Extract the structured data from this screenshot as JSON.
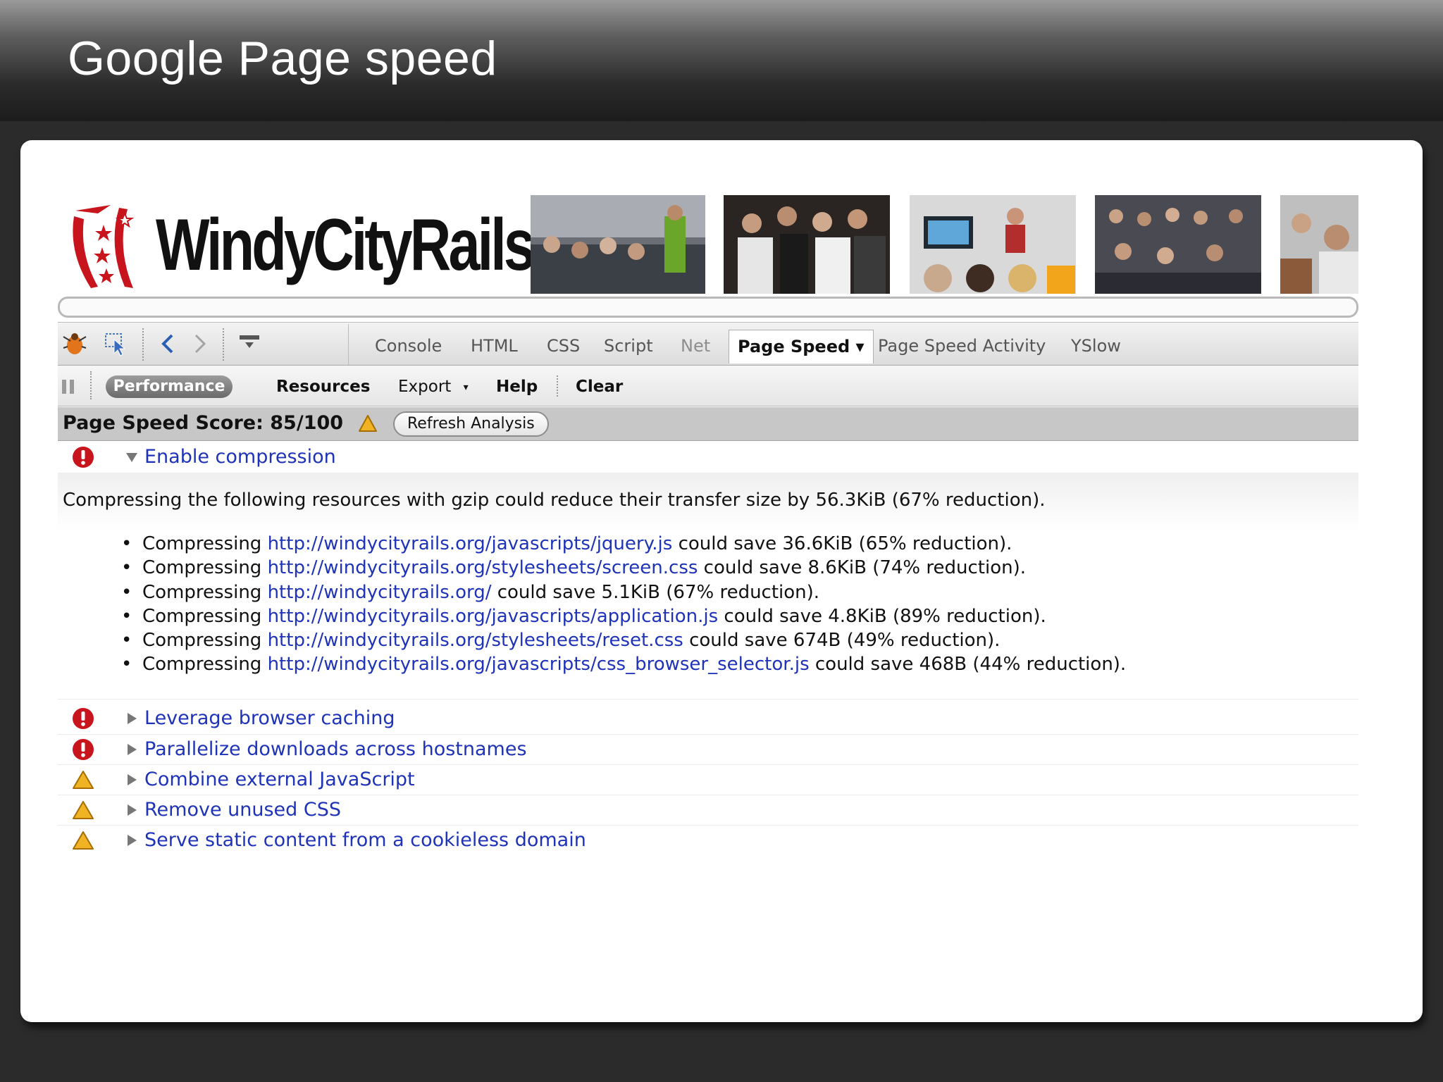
{
  "slide": {
    "title": "Google Page speed"
  },
  "banner": {
    "logo_text": "WindyCityRails"
  },
  "toolbar": {
    "tabs": [
      "Console",
      "HTML",
      "CSS",
      "Script",
      "Net",
      "Page Speed",
      "Page Speed Activity",
      "YSlow"
    ],
    "active_tab": "Page Speed",
    "dropdown_glyph": "▾"
  },
  "subtoolbar": {
    "performance": "Performance",
    "resources": "Resources",
    "export": "Export",
    "export_arrow": "▾",
    "help": "Help",
    "clear": "Clear"
  },
  "score": {
    "label": "Page Speed Score: 85/100",
    "refresh": "Refresh Analysis"
  },
  "expanded_rule": {
    "severity": "error",
    "title": "Enable compression",
    "summary": "Compressing the following resources with gzip could reduce their transfer size by 56.3KiB (67% reduction).",
    "items": [
      {
        "prefix": "Compressing ",
        "url": "http://windycityrails.org/javascripts/jquery.js",
        "suffix": " could save 36.6KiB (65% reduction)."
      },
      {
        "prefix": "Compressing ",
        "url": "http://windycityrails.org/stylesheets/screen.css",
        "suffix": " could save 8.6KiB (74% reduction)."
      },
      {
        "prefix": "Compressing ",
        "url": "http://windycityrails.org/",
        "suffix": " could save 5.1KiB (67% reduction)."
      },
      {
        "prefix": "Compressing ",
        "url": "http://windycityrails.org/javascripts/application.js",
        "suffix": " could save 4.8KiB (89% reduction)."
      },
      {
        "prefix": "Compressing ",
        "url": "http://windycityrails.org/stylesheets/reset.css",
        "suffix": " could save 674B (49% reduction)."
      },
      {
        "prefix": "Compressing ",
        "url": "http://windycityrails.org/javascripts/css_browser_selector.js",
        "suffix": " could save 468B (44% reduction)."
      }
    ]
  },
  "rules": [
    {
      "severity": "error",
      "title": "Leverage browser caching"
    },
    {
      "severity": "error",
      "title": "Parallelize downloads across hostnames"
    },
    {
      "severity": "warning",
      "title": "Combine external JavaScript"
    },
    {
      "severity": "warning",
      "title": "Remove unused CSS"
    },
    {
      "severity": "warning",
      "title": "Serve static content from a cookieless domain"
    }
  ],
  "colors": {
    "link": "#1f33b8",
    "error": "#c8141c",
    "warning": "#e8a317",
    "logo_red": "#c8141c"
  },
  "icons": [
    "firebug-icon",
    "inspect-icon",
    "back-icon",
    "forward-icon",
    "panel-menu-icon",
    "pause-icon",
    "error-icon",
    "warning-icon",
    "expanded-triangle-icon",
    "collapsed-triangle-icon"
  ]
}
